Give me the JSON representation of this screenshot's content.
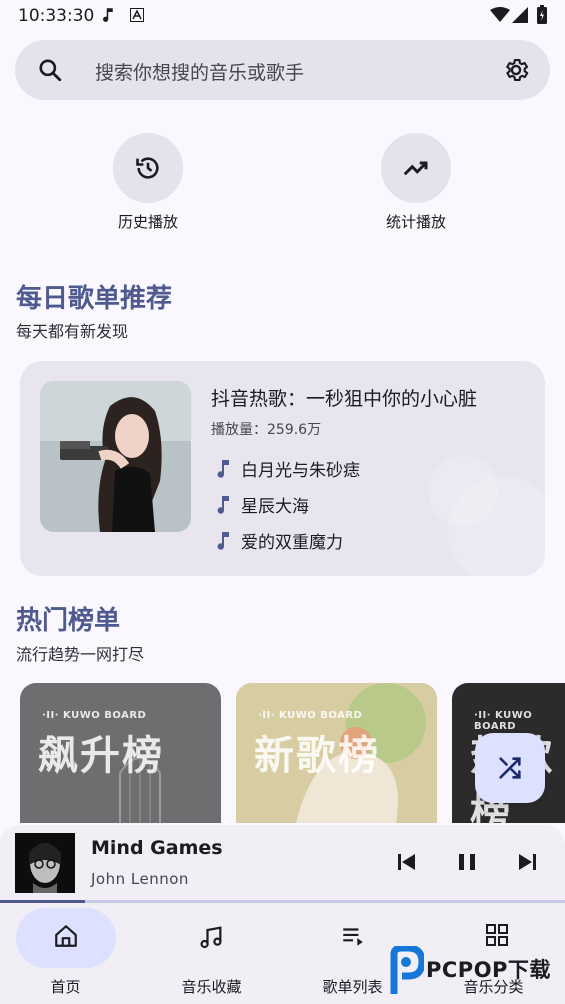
{
  "status_bar": {
    "time": "10:33:30"
  },
  "search": {
    "placeholder": "搜索你想搜的音乐或歌手"
  },
  "quick_actions": [
    {
      "label": "历史播放",
      "icon": "history-icon"
    },
    {
      "label": "统计播放",
      "icon": "trending-up-icon"
    }
  ],
  "daily": {
    "title": "每日歌单推荐",
    "subtitle": "每天都有新发现",
    "playlist": {
      "name": "抖音热歌：一秒狙中你的小心脏",
      "plays": "播放量：259.6万",
      "songs": [
        "白月光与朱砂痣",
        "星辰大海",
        "爱的双重魔力"
      ]
    }
  },
  "charts": {
    "title": "热门榜单",
    "subtitle": "流行趋势一网打尽",
    "items": [
      {
        "brand": "·II· KUWO BOARD",
        "name": "飙升榜",
        "color": "#6e6e70"
      },
      {
        "brand": "·II· KUWO BOARD",
        "name": "新歌榜",
        "color": "#c9b98a"
      },
      {
        "brand": "·II· KUWO BOARD",
        "name": "热歌榜",
        "color": "#2b2b2b"
      }
    ]
  },
  "player": {
    "title": "Mind Games",
    "artist": "John Lennon",
    "progress": 0.15
  },
  "nav": {
    "items": [
      {
        "label": "首页",
        "icon": "home-icon",
        "active": true
      },
      {
        "label": "音乐收藏",
        "icon": "music-collection-icon",
        "active": false
      },
      {
        "label": "歌单列表",
        "icon": "playlist-icon",
        "active": false
      },
      {
        "label": "音乐分类",
        "icon": "category-grid-icon",
        "active": false
      }
    ]
  },
  "watermark": {
    "text": "PCPOP下载"
  },
  "colors": {
    "accent": "#4f5a8f",
    "surface": "#faf7fe",
    "container": "#e6e2ec",
    "active_pill": "#dde1ff"
  }
}
